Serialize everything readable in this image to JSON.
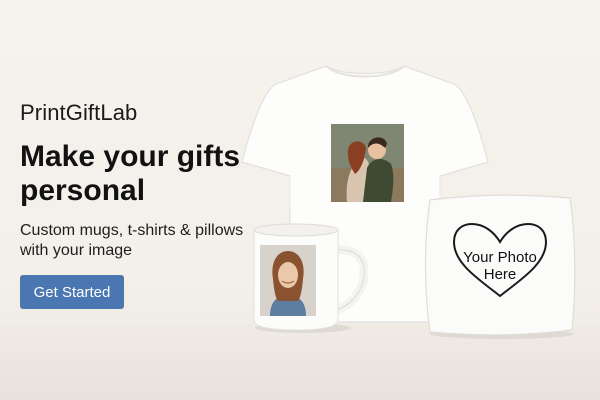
{
  "brand": {
    "name": "PrintGiftLab"
  },
  "hero": {
    "headline": "Make your gifts personal",
    "subtext": "Custom mugs, t-shirts & pillows with your image",
    "cta_label": "Get Started"
  },
  "products": {
    "tshirt": {
      "photo": "couple-kissing-photo"
    },
    "mug": {
      "photo": "smiling-woman-portrait"
    },
    "pillow": {
      "label": "Your Photo Here"
    }
  },
  "colors": {
    "accent": "#4a76b2",
    "background": "#f5f2ed"
  }
}
